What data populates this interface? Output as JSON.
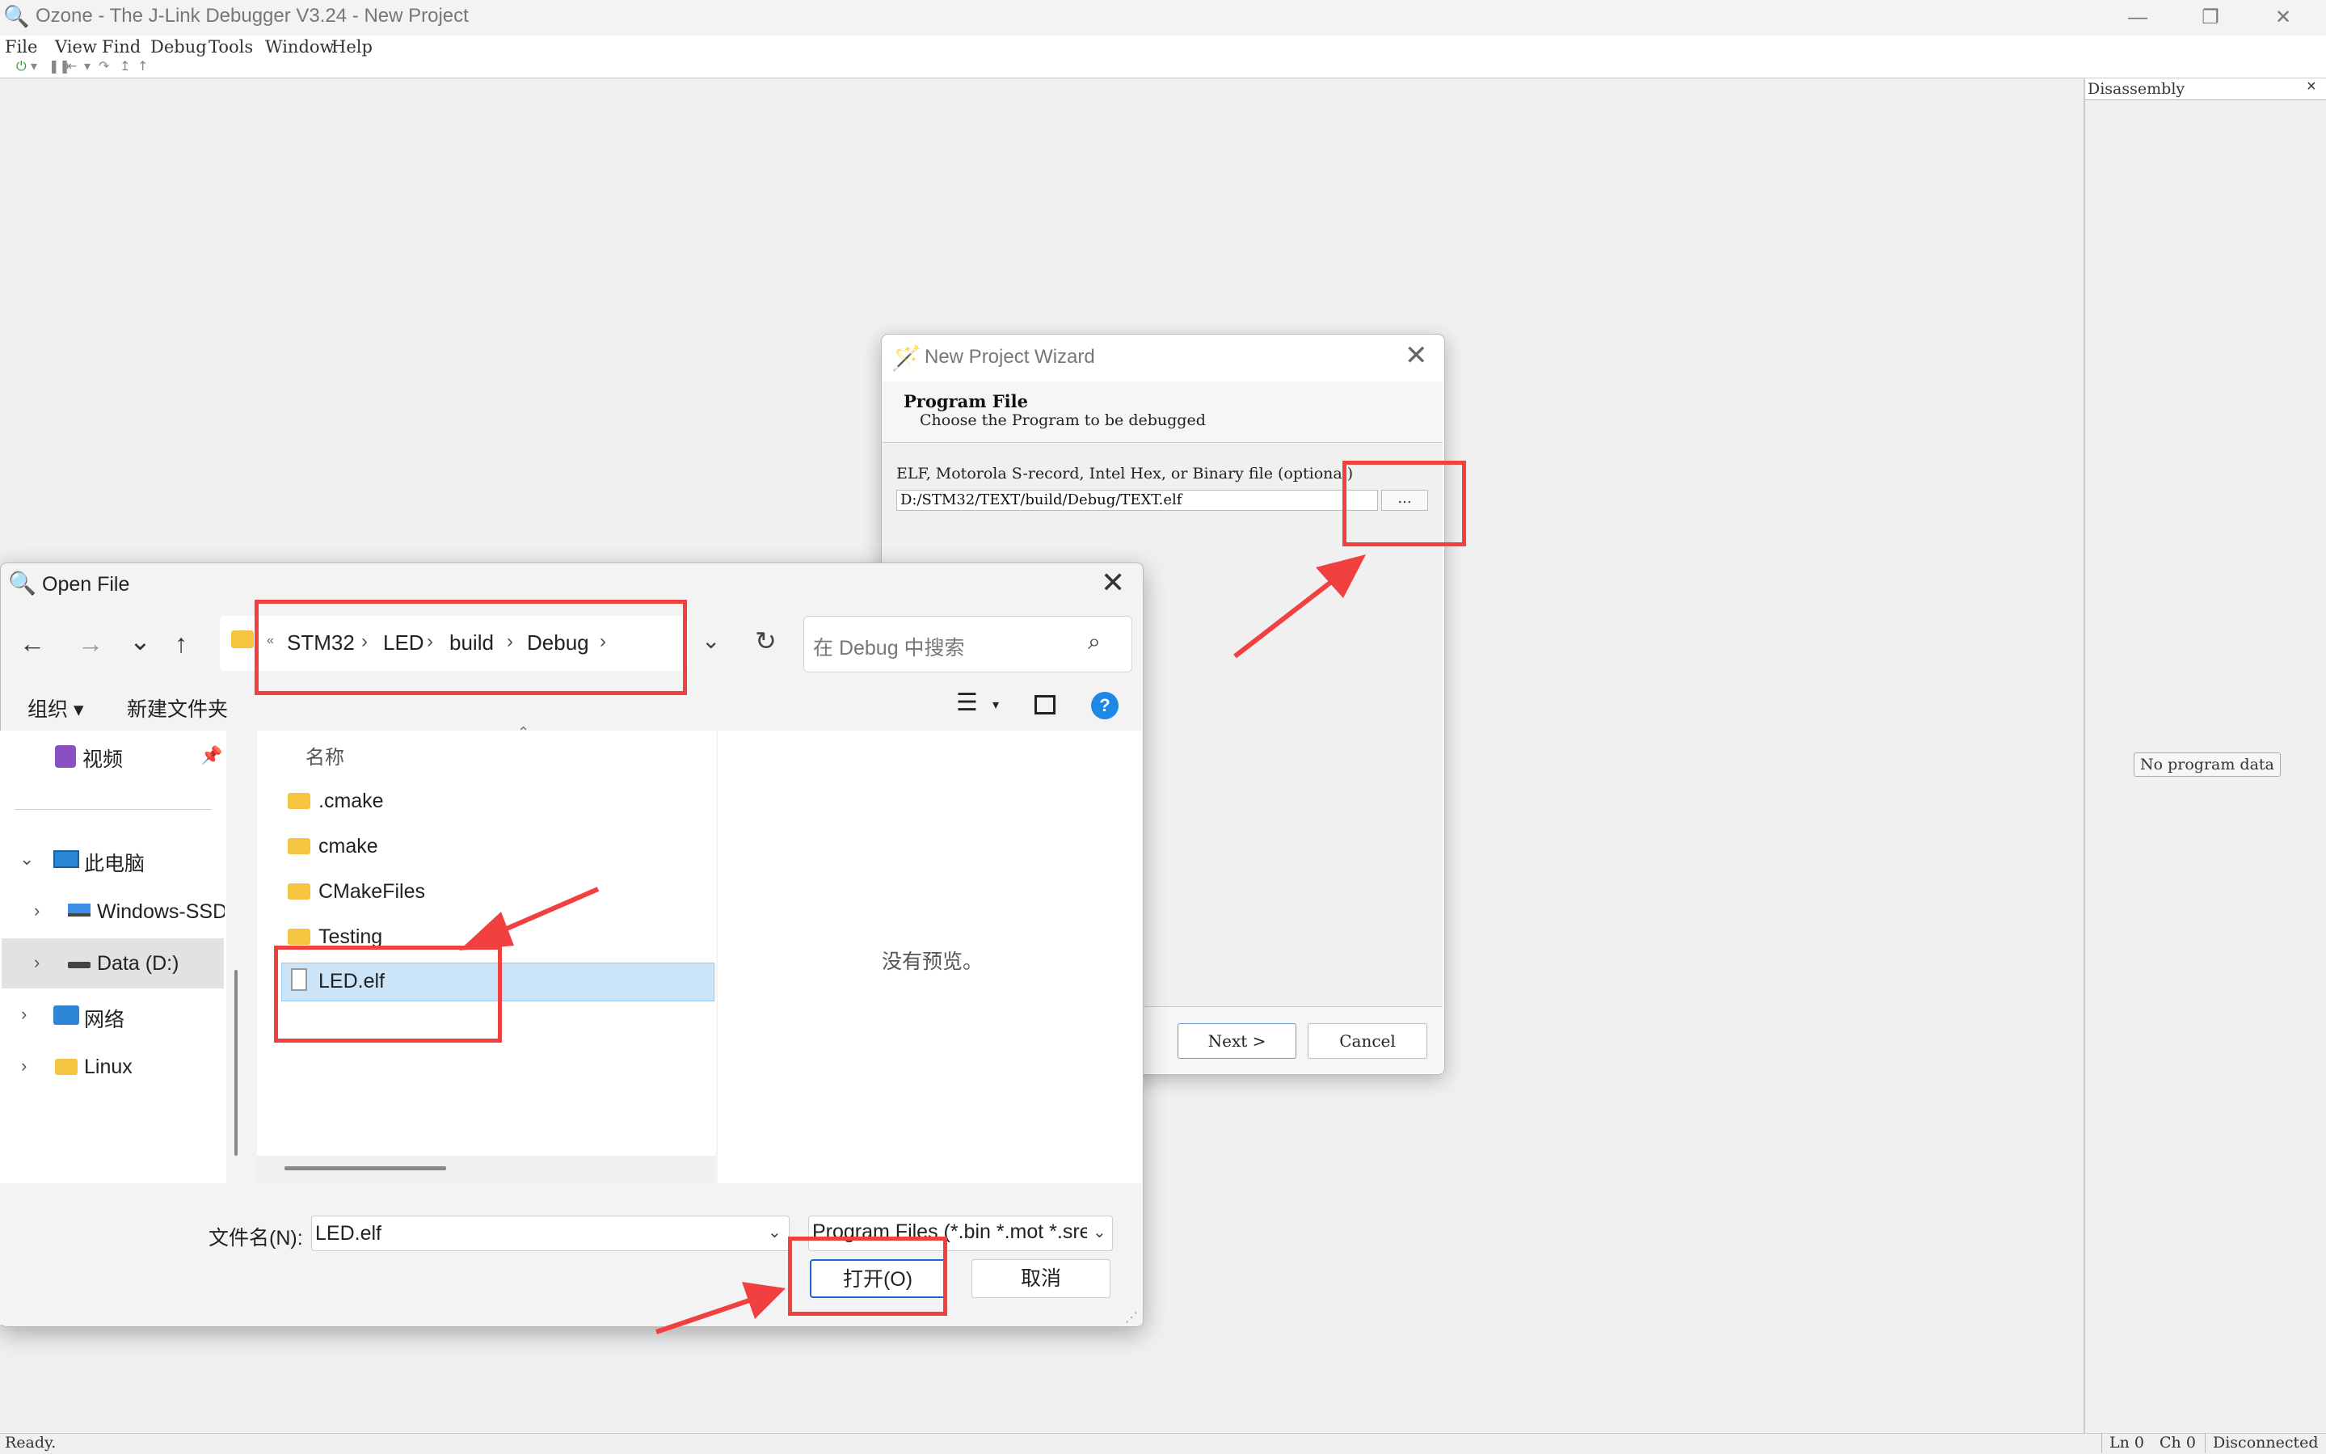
{
  "app": {
    "title": "Ozone - The J-Link Debugger V3.24 - New Project",
    "window_controls": {
      "minimize": "—",
      "maximize": "❐",
      "close": "✕"
    },
    "menu": [
      "File",
      "View",
      "Find",
      "Debug",
      "Tools",
      "Window",
      "Help"
    ],
    "toolbar": [
      "⏻",
      "▾",
      "❚❚",
      "⇤",
      "▾",
      "↷",
      "↥",
      "↑"
    ]
  },
  "disassembly": {
    "title": "Disassembly",
    "close": "×",
    "placeholder": "No program data"
  },
  "status": {
    "left": "Ready.",
    "ln": "Ln 0",
    "ch": "Ch 0",
    "conn": "Disconnected"
  },
  "wizard": {
    "title": "New Project Wizard",
    "close": "✕",
    "heading": "Program File",
    "subheading": "Choose the Program to be debugged",
    "field_label": "ELF, Motorola S-record, Intel Hex, or Binary file (optional)",
    "path": "D:/STM32/TEXT/build/Debug/TEXT.elf",
    "browse": "...",
    "next": "Next >",
    "cancel": "Cancel"
  },
  "open_dialog": {
    "title": "Open File",
    "close": "✕",
    "nav": {
      "back": "←",
      "forward": "→",
      "recent": "⌄",
      "up": "↑"
    },
    "breadcrumb_more": "«",
    "breadcrumbs": [
      "STM32",
      "LED",
      "build",
      "Debug"
    ],
    "crumb_sep": "›",
    "search_placeholder": "在 Debug 中搜索",
    "commands": {
      "organize": "组织 ▾",
      "new_folder": "新建文件夹"
    },
    "help": "?",
    "nav_items": [
      {
        "label": "视频"
      },
      {
        "label": "此电脑"
      },
      {
        "label": "Windows-SSD"
      },
      {
        "label": "Data (D:)"
      },
      {
        "label": "网络"
      },
      {
        "label": "Linux"
      }
    ],
    "column_name": "名称",
    "sort_glyph": "⌃",
    "files": [
      ".cmake",
      "cmake",
      "CMakeFiles",
      "Testing",
      "LED.elf"
    ],
    "no_preview": "没有预览。",
    "filename_label": "文件名(N):",
    "filename_value": "LED.elf",
    "filetype_value": "Program Files (*.bin *.mot *.srec *.hex *.elf)",
    "open_button": "打开(O)",
    "cancel_button": "取消"
  },
  "colors": {
    "annotation": "#f04040",
    "selection": "#cce4f7",
    "accent": "#1d66d0",
    "folder": "#f5c542"
  }
}
